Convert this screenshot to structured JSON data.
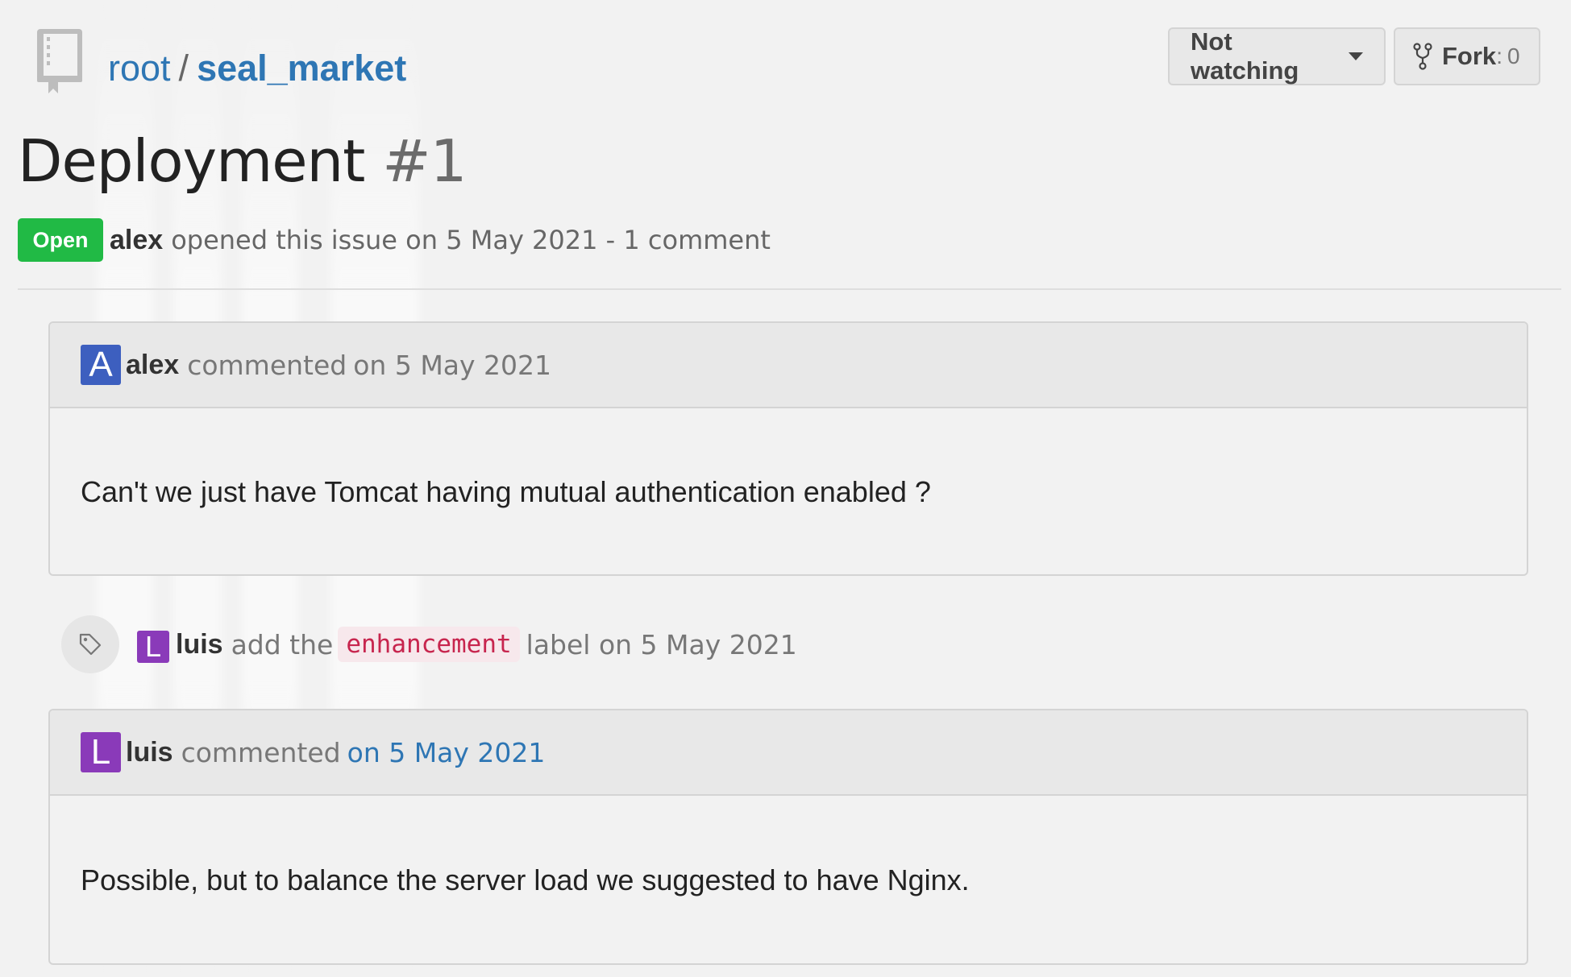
{
  "repo": {
    "owner": "root",
    "separator": "/",
    "name": "seal_market"
  },
  "actions": {
    "watch_label": "Not watching",
    "fork_label": "Fork",
    "fork_sep": ":",
    "fork_count": "0"
  },
  "issue": {
    "title": "Deployment",
    "number": "#1",
    "state": "Open",
    "author": "alex",
    "meta_text": "opened this issue on 5 May 2021 - 1 comment"
  },
  "comments": [
    {
      "avatar_letter": "A",
      "avatar_color": "#3d5fbf",
      "author": "alex",
      "action": "commented",
      "date": "on 5 May 2021",
      "body": "Can't we just have Tomcat having mutual authentication enabled ?"
    },
    {
      "avatar_letter": "L",
      "avatar_color": "#8a3ab9",
      "author": "luis",
      "action": "commented",
      "date": "on 5 May 2021",
      "body": "Possible, but to balance the server load we suggested to have Nginx."
    }
  ],
  "event": {
    "icon": "tag-icon",
    "avatar_letter": "L",
    "avatar_color": "#8a3ab9",
    "actor": "luis",
    "prefix": "add the",
    "label": "enhancement",
    "suffix": "label on 5 May 2021"
  },
  "colors": {
    "link": "#2e76b4",
    "open_badge": "#21ba45",
    "label_text": "#c7254e"
  }
}
